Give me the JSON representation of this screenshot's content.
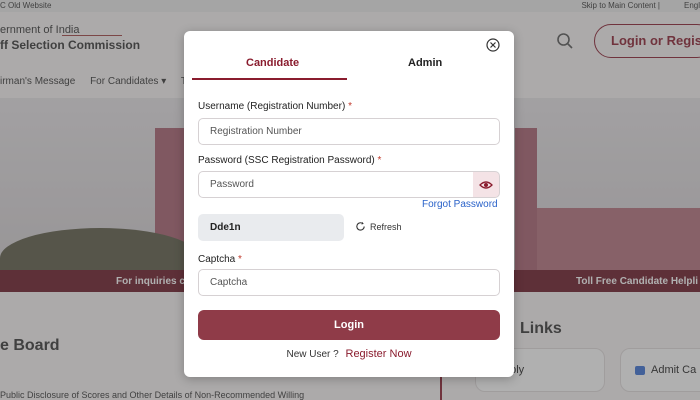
{
  "background": {
    "old_website": "C Old Website",
    "skip_link": "Skip to Main Content |",
    "language": "Engl",
    "brand_line1": "ernment of India",
    "brand_line2": "ff Selection Commission",
    "login_register": "Login or Register",
    "nav_items": [
      "irman's Message",
      "For Candidates ▾",
      "Te"
    ],
    "ticker_left": "For inquiries c",
    "ticker_right": "Toll Free Candidate Helpli",
    "board_title": "e Board",
    "links_title": "Links",
    "board_text": "Public Disclosure of Scores and Other Details of Non-Recommended Willing",
    "card_apply": "pply",
    "card_admit": "Admit Ca"
  },
  "modal": {
    "tabs": {
      "candidate": "Candidate",
      "admin": "Admin",
      "active": "candidate"
    },
    "username_label": "Username (Registration Number)",
    "username_placeholder": "Registration Number",
    "password_label": "Password (SSC Registration Password)",
    "password_placeholder": "Password",
    "required_mark": "*",
    "forgot_password": "Forgot Password",
    "captcha_code": "Dde1n",
    "refresh_label": "Refresh",
    "captcha_label": "Captcha",
    "captcha_placeholder": "Captcha",
    "login_button": "Login",
    "new_user_text": "New User ?",
    "register_now": "Register Now"
  },
  "icons": [
    "close-icon",
    "eye-icon",
    "refresh-icon",
    "search-icon"
  ],
  "colors": {
    "accent": "#8a1c2e",
    "button": "#8f3b48",
    "link": "#2a62c9"
  }
}
